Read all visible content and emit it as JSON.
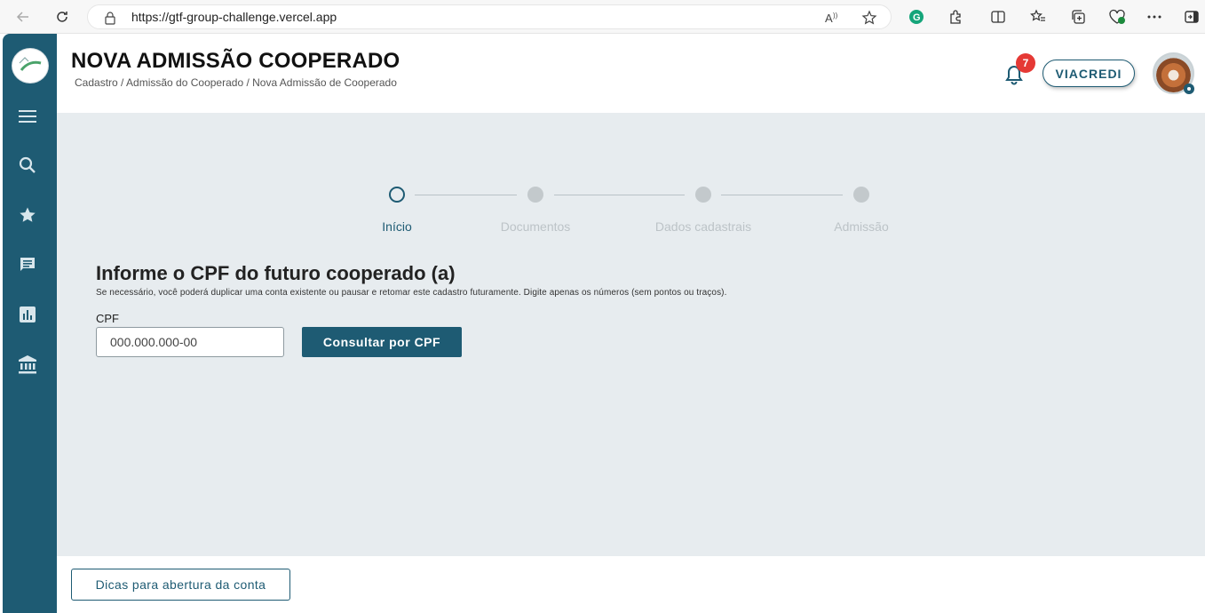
{
  "browser": {
    "url": "https://gtf-group-challenge.vercel.app"
  },
  "header": {
    "title": "NOVA ADMISSÃO COOPERADO",
    "breadcrumb": "Cadastro / Admissão do Cooperado / Nova Admissão de Cooperado",
    "notification_count": "7",
    "company_label": "VIACREDI"
  },
  "sidebar": {
    "icons": [
      "menu-icon",
      "search-icon",
      "star-icon",
      "chat-icon",
      "chart-icon",
      "bank-icon"
    ]
  },
  "stepper": {
    "steps": [
      {
        "label": "Início",
        "active": true
      },
      {
        "label": "Documentos",
        "active": false
      },
      {
        "label": "Dados cadastrais",
        "active": false
      },
      {
        "label": "Admissão",
        "active": false
      }
    ]
  },
  "form": {
    "title": "Informe o CPF do futuro cooperado (a)",
    "subtitle": "Se necessário, você poderá duplicar uma conta existente ou pausar e retomar este cadastro futuramente. Digite apenas os números (sem pontos ou traços).",
    "cpf_label": "CPF",
    "cpf_placeholder": "000.000.000-00",
    "submit_label": "Consultar por CPF"
  },
  "footer": {
    "tips_label": "Dicas para abertura da conta"
  },
  "colors": {
    "primary": "#1e5b73",
    "background": "#e7ecef",
    "badge": "#e53935"
  }
}
